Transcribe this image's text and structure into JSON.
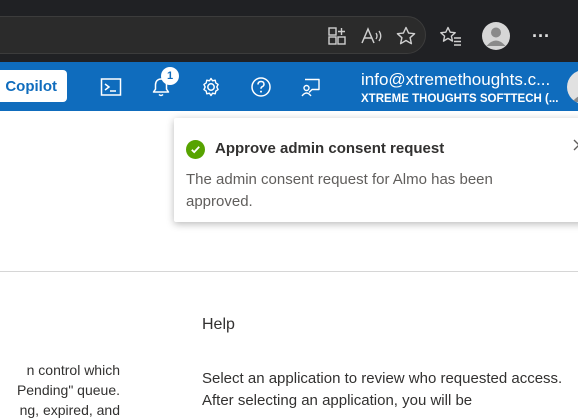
{
  "browser": {
    "icons": [
      "app-add-icon",
      "read-aloud-icon",
      "favorite-star-icon",
      "favorites-list-icon",
      "profile-icon",
      "more-icon"
    ],
    "more_label": "···"
  },
  "portal": {
    "copilot_label": "Copilot",
    "notification_count": "1",
    "account_email": "info@xtremethoughts.c...",
    "account_org": "XTREME THOUGHTS SOFTTECH (..."
  },
  "toast": {
    "title": "Approve admin consent request",
    "message": "The admin consent request for Almo has been approved.",
    "status_color": "#57a300"
  },
  "content": {
    "left_lines": [
      "n control which",
      "Pending\" queue.",
      "ng, expired, and"
    ],
    "help_heading": "Help",
    "help_body": "Select an application to review who requested access. After selecting an application, you will be"
  },
  "colors": {
    "portal_blue": "#0f6cbd",
    "browser_dark": "#202124"
  }
}
